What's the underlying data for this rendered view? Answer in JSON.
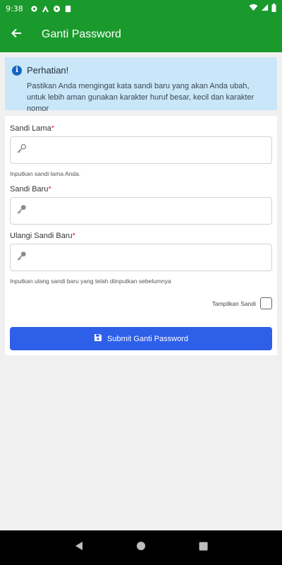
{
  "status_bar": {
    "time": "9:38"
  },
  "app_bar": {
    "title": "Ganti Password"
  },
  "alert": {
    "title": "Perhatian!",
    "icon_glyph": "i",
    "body": "Pastikan Anda mengingat kata sandi baru yang akan Anda ubah, untuk lebih aman gunakan karakter huruf besar, kecil dan karakter nomor"
  },
  "form": {
    "old_password": {
      "label": "Sandi Lama",
      "required_mark": "*",
      "value": "",
      "placeholder": "",
      "helper": "Inputkan sandi lama Anda."
    },
    "new_password": {
      "label": "Sandi Baru",
      "required_mark": "*",
      "value": "",
      "placeholder": ""
    },
    "confirm_password": {
      "label": "Ulangi Sandi Baru",
      "required_mark": "*",
      "value": "",
      "placeholder": "",
      "helper": "Inputkan ulang sandi baru yang telah diinputkan sebelumnya"
    },
    "show_password_label": "Tampilkan Sandi",
    "show_password_checked": false,
    "submit_label": "Submit Ganti Password"
  },
  "colors": {
    "app_bar": "#1a9a2c",
    "alert_bg": "#c9e7f9",
    "alert_icon": "#1565c0",
    "submit": "#2e5fe8",
    "required": "#d32f2f"
  },
  "icons": {
    "back": "arrow-left-icon",
    "info": "info-icon",
    "field": "key-icon",
    "submit": "floppy-disk-icon"
  }
}
